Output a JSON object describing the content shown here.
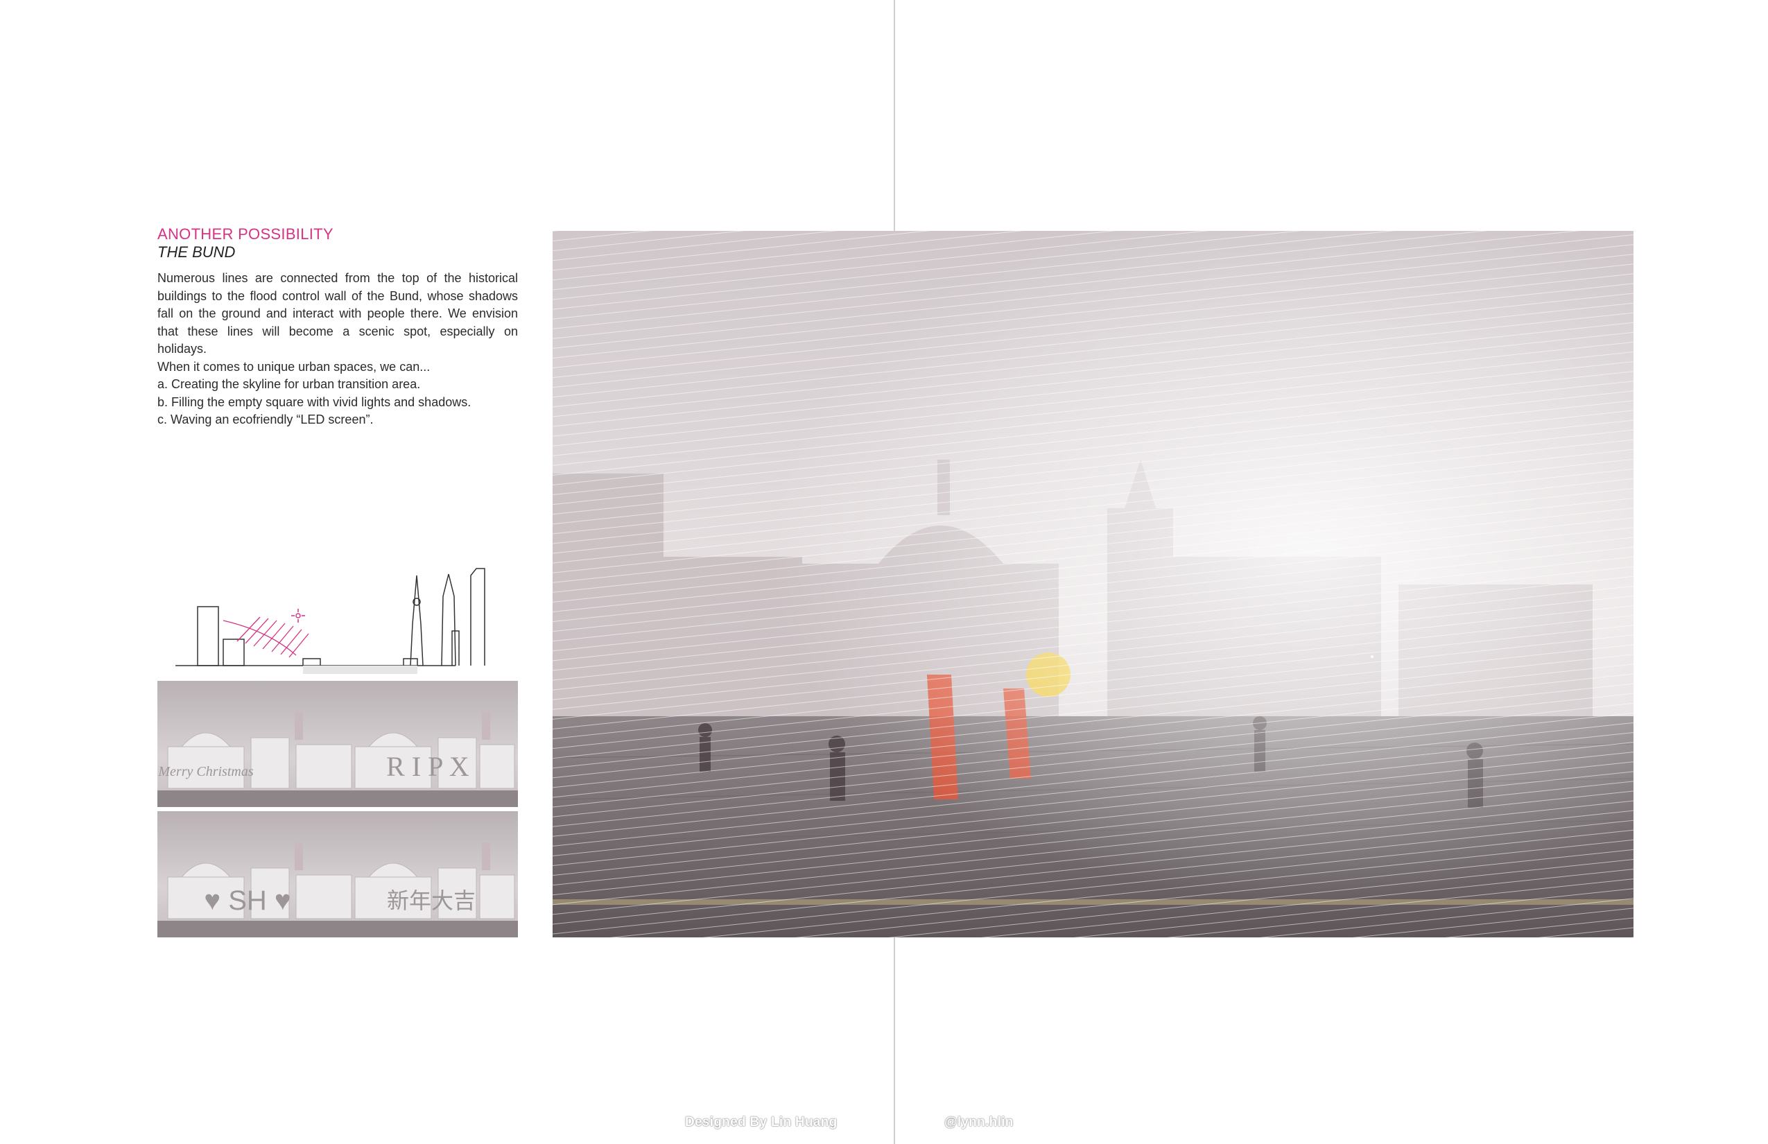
{
  "heading": {
    "title": "ANOTHER POSSIBILITY",
    "subtitle": "THE BUND"
  },
  "body": {
    "paragraph": "Numerous lines are connected from the top of the historical buildings to the flood control wall of the Bund, whose shadows fall on the ground and interact with people there. We envision that these lines will become a scenic spot, especially on holidays.",
    "intro": "When it comes to unique urban spaces, we can...",
    "item_a": "a. Creating the skyline for urban transition area.",
    "item_b": "b. Filling the empty square with vivid lights and shadows.",
    "item_c": "c. Waving an ecofriendly “LED screen”."
  },
  "thumbnails": {
    "panel1_left_text": "Merry Christmas",
    "panel1_right_text": "R I P X",
    "panel2_left_text": "♥ SH ♥",
    "panel2_right_text": "新年大吉"
  },
  "footer": {
    "credit": "Designed By Lin Huang",
    "handle": "@lynn.hlin"
  },
  "colors": {
    "accent": "#d63384"
  }
}
